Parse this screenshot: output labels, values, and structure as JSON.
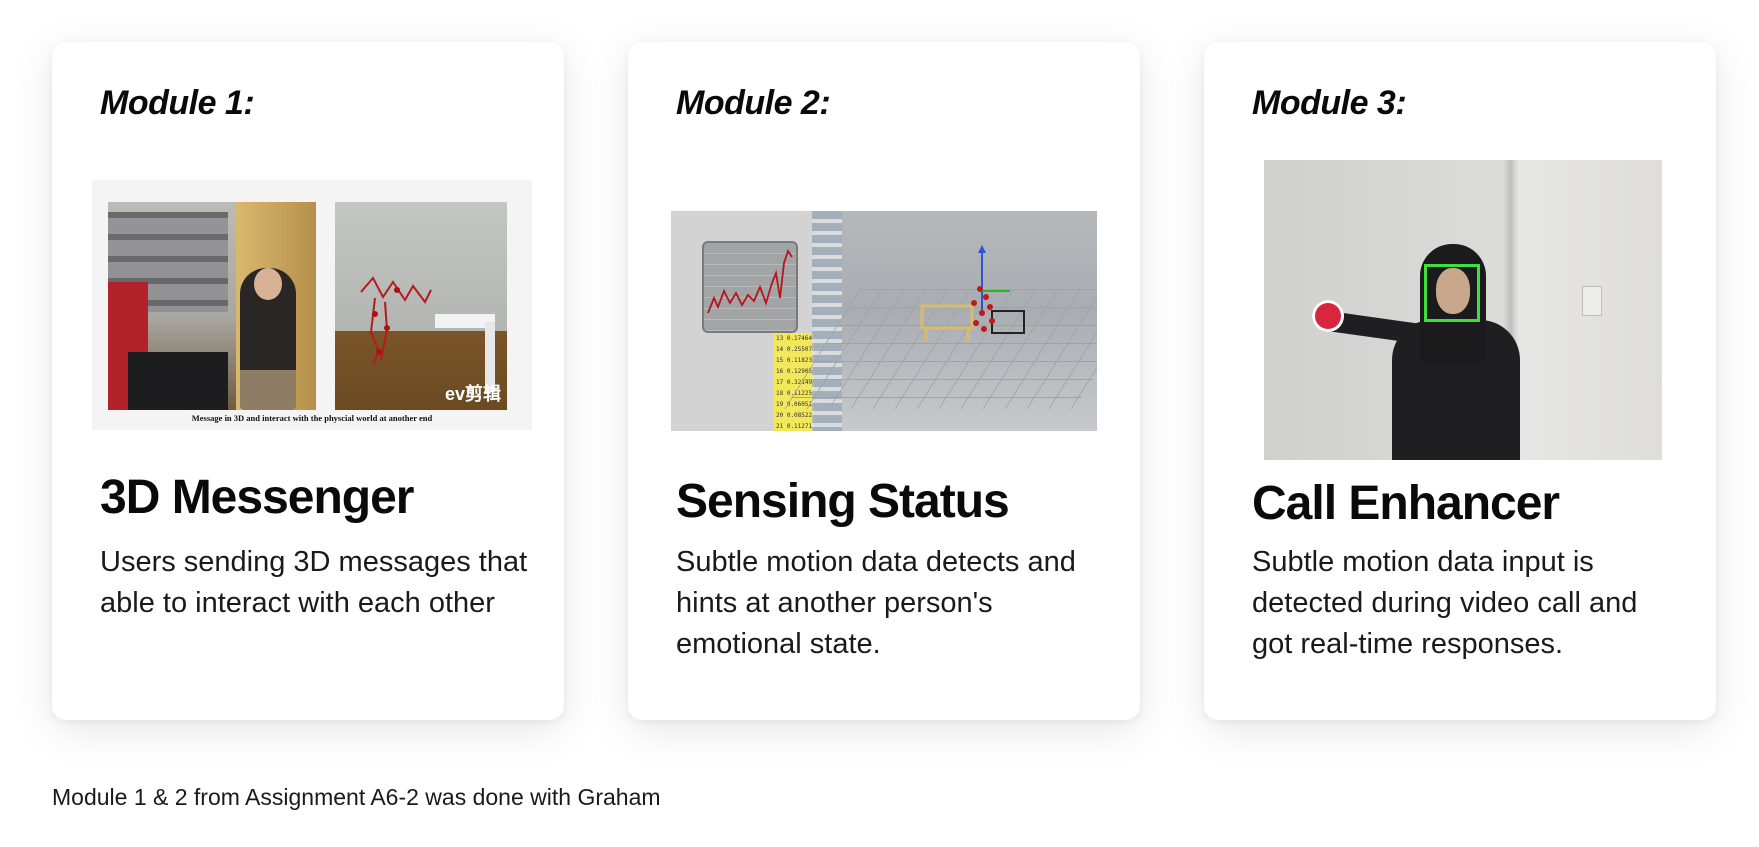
{
  "modules": [
    {
      "label": "Module 1:",
      "title": "3D Messenger",
      "description": "Users sending 3D messages that able to interact with each other",
      "image_caption": "Message in 3D and interact with the physcial world at another end",
      "image_brand": "ev剪辑"
    },
    {
      "label": "Module 2:",
      "title": "Sensing Status",
      "description": "Subtle motion data detects and hints at another person's emotional state.",
      "image_numbers": [
        "13 0.17464",
        "14 0.25507",
        "15 0.11823",
        "16 0.12905",
        "17 0.32149",
        "18 0.11225",
        "19 0.06051",
        "20 0.08522",
        "21 0.11271"
      ]
    },
    {
      "label": "Module 3:",
      "title": "Call Enhancer",
      "description": "Subtle motion data input is detected during video call and got real-time responses."
    }
  ],
  "footnote": "Module 1 & 2 from Assignment A6-2 was done with Graham"
}
